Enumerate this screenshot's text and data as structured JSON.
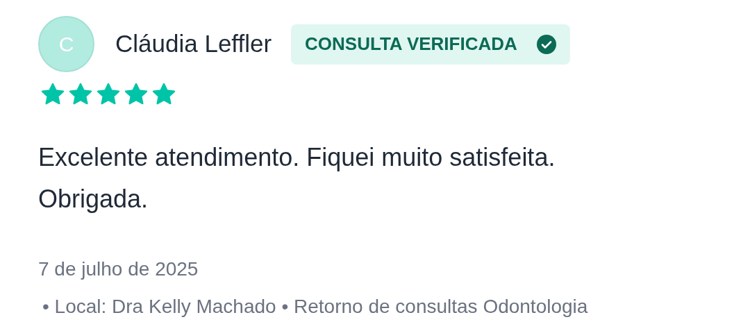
{
  "review": {
    "avatar_initial": "C",
    "author": "Cláudia Leffler",
    "badge": {
      "label": "CONSULTA VERIFICADA",
      "verified": true
    },
    "stars": 5,
    "text": "Excelente atendimento. Fiquei muito satisfeita. Obrigada.",
    "date": "7 de julho de 2025",
    "details": "• Local: Dra Kelly Machado • Retorno de consultas Odontologia"
  }
}
